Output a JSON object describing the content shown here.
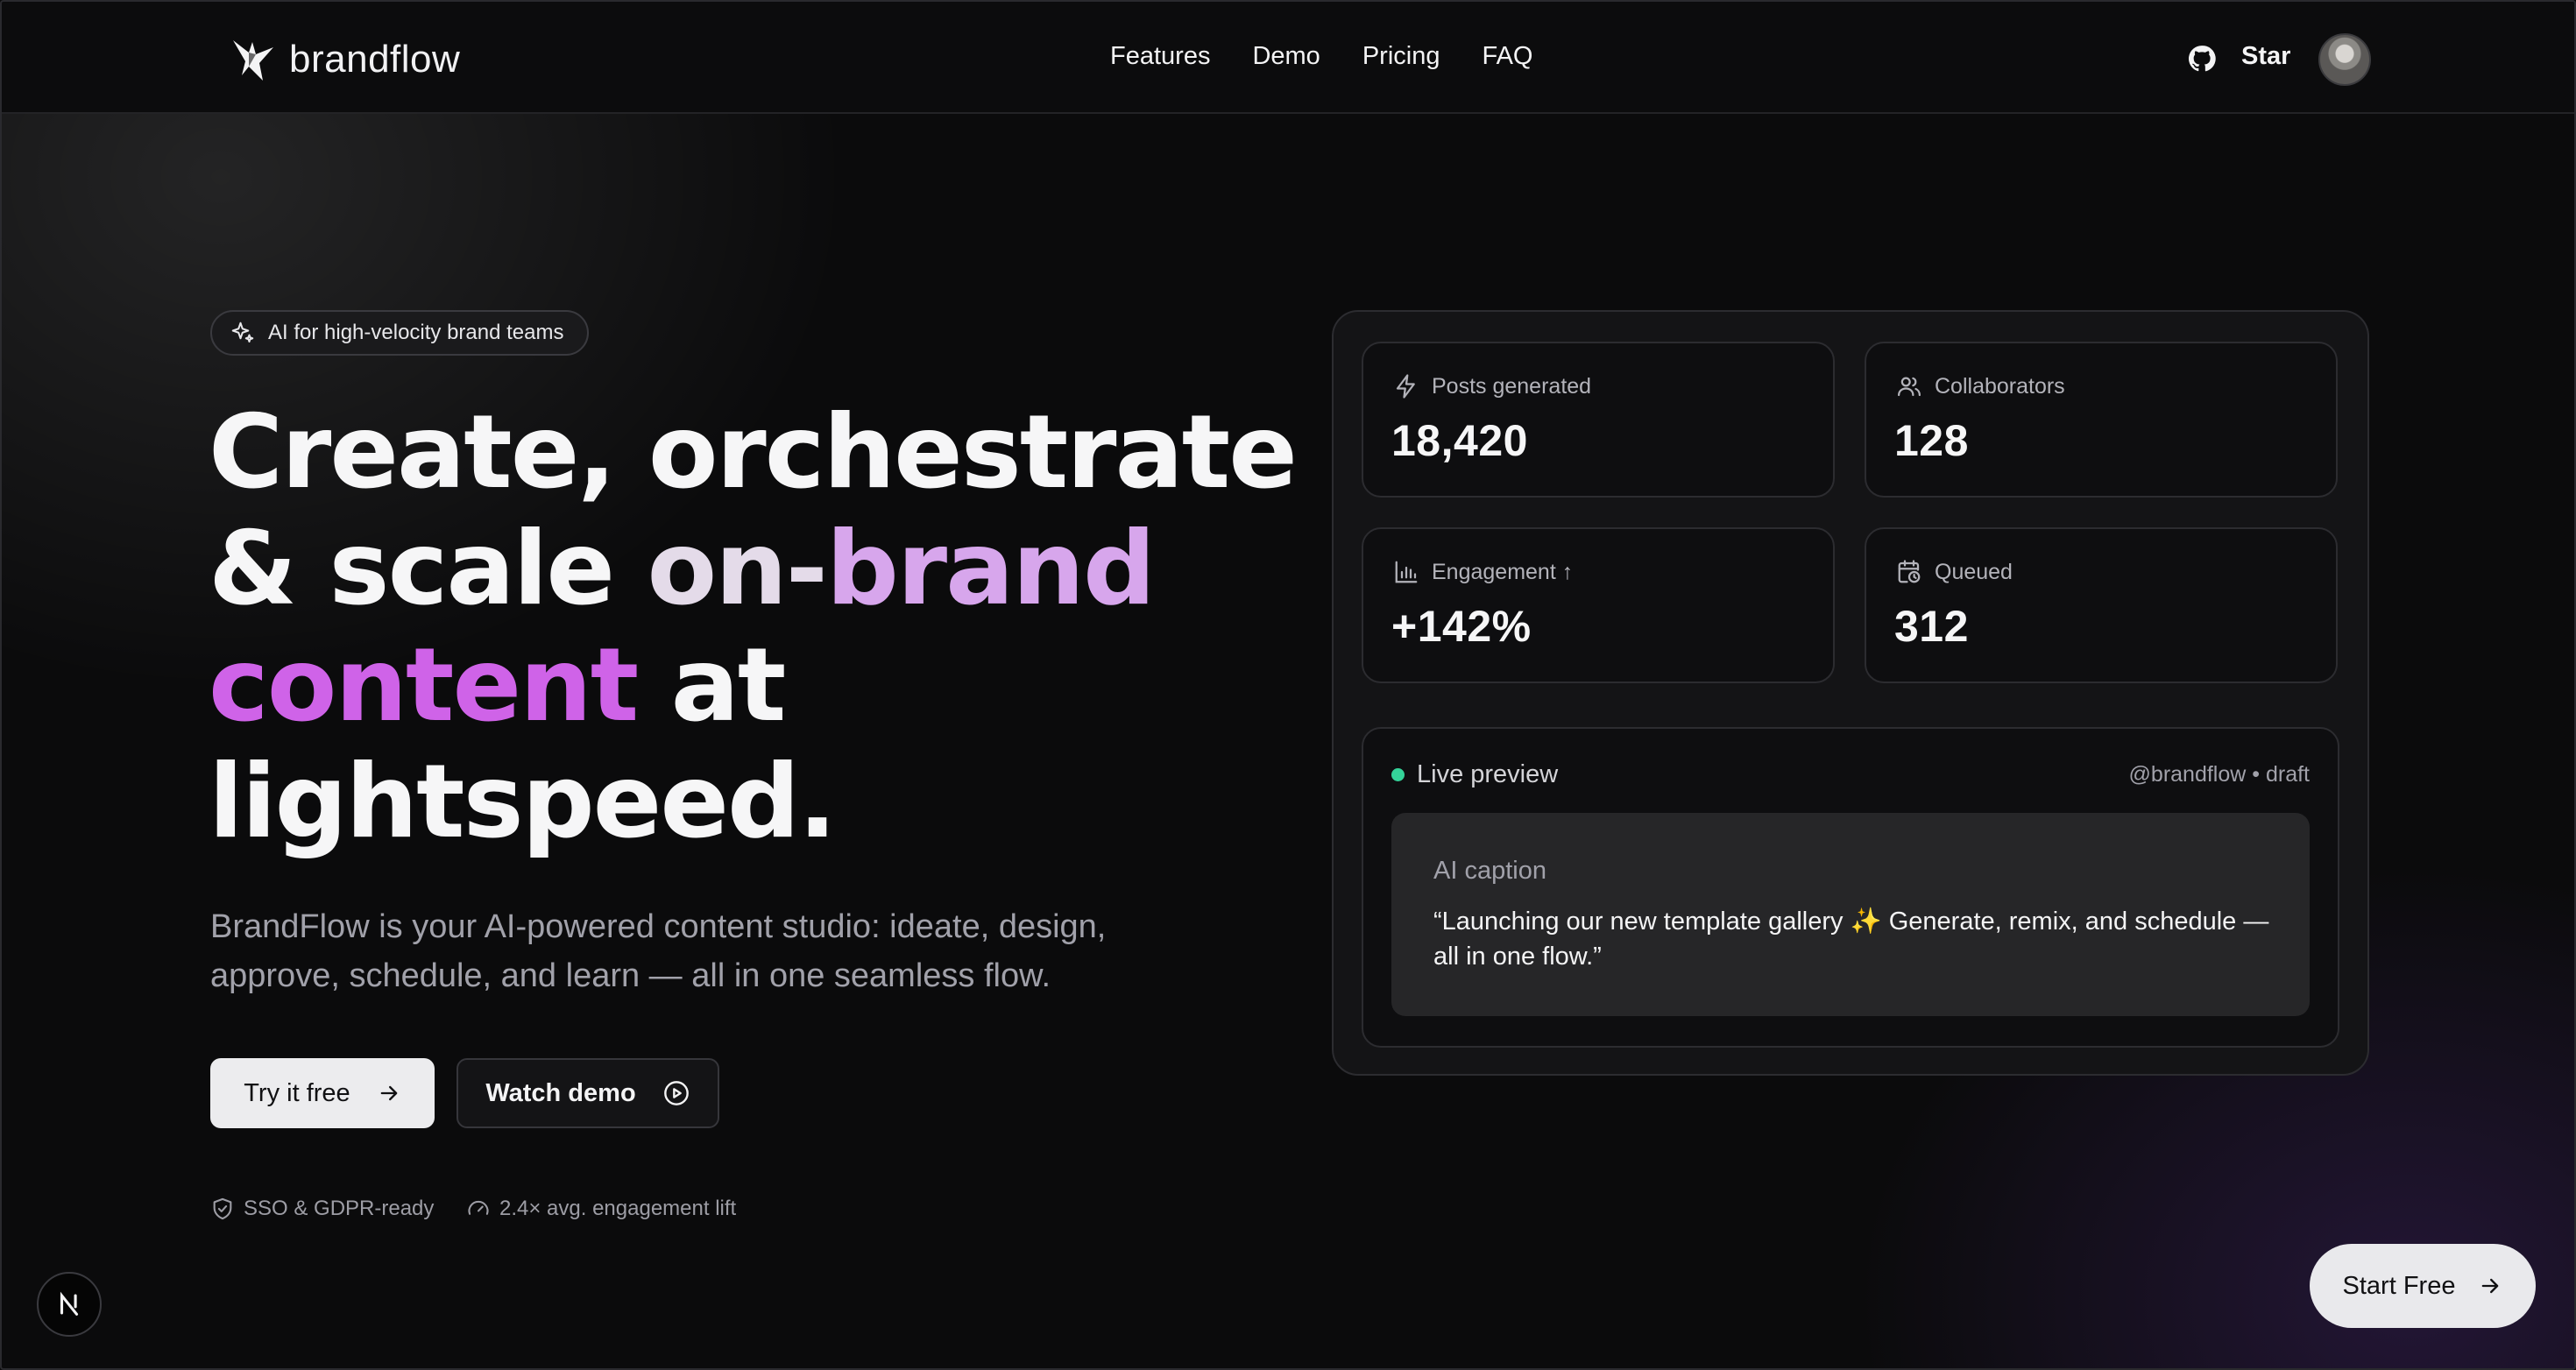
{
  "brand": {
    "name": "brandflow"
  },
  "nav": {
    "links": [
      "Features",
      "Demo",
      "Pricing",
      "FAQ"
    ],
    "star_label": "Star"
  },
  "hero": {
    "badge": "AI for high-velocity brand teams",
    "headline": {
      "line1": "Create, orchestrate",
      "line2_plain": "& scale ",
      "line2_grad_a": "on-",
      "line2_grad_b": "brand",
      "line3_grad": "content",
      "line3_plain": " at",
      "line4": "lightspeed."
    },
    "subtitle": "BrandFlow is your AI-powered content studio: ideate, design, approve, schedule, and learn — all in one seamless flow.",
    "primary_cta": "Try it free",
    "secondary_cta": "Watch demo",
    "trust": [
      "SSO & GDPR-ready",
      "2.4× avg. engagement lift"
    ]
  },
  "stats": [
    {
      "label": "Posts generated",
      "value": "18,420",
      "icon": "bolt-icon"
    },
    {
      "label": "Collaborators",
      "value": "128",
      "icon": "users-icon"
    },
    {
      "label": "Engagement ↑",
      "value": "+142%",
      "icon": "bar-chart-icon"
    },
    {
      "label": "Queued",
      "value": "312",
      "icon": "calendar-clock-icon"
    }
  ],
  "preview": {
    "title": "Live preview",
    "handle": "@brandflow • draft",
    "caption_title": "AI caption",
    "caption_text": "“Launching our new template gallery ✨ Generate, remix, and schedule — all in one flow.”"
  },
  "floating": {
    "start_free": "Start Free"
  },
  "colors": {
    "accent_purple": "#cf63e8",
    "live_green": "#34d399",
    "background": "#0b0b0c"
  }
}
